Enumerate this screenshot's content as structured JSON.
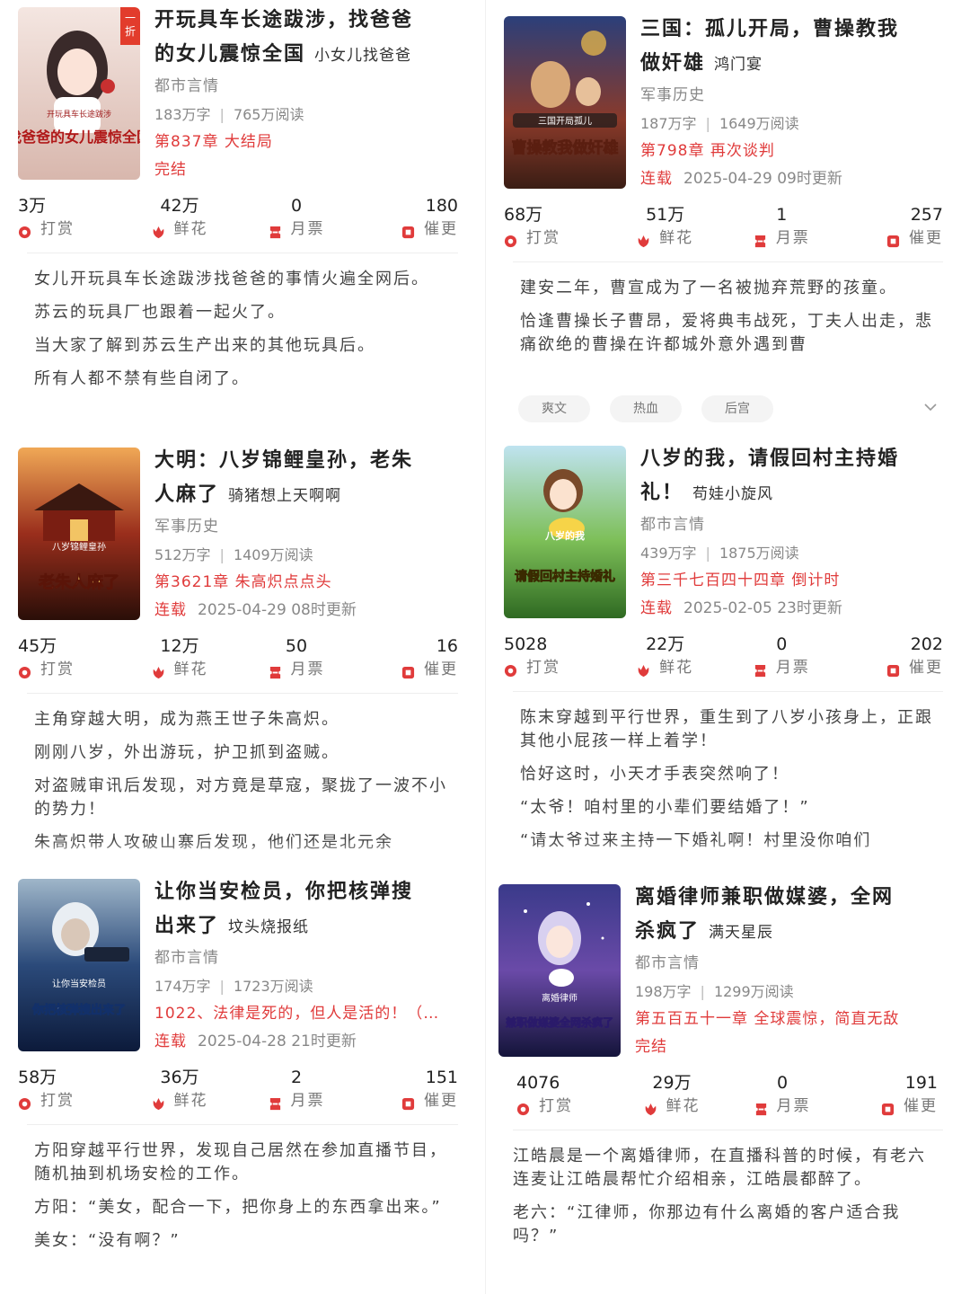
{
  "labels": {
    "reward": "打赏",
    "flower": "鲜花",
    "ticket": "月票",
    "urge": "催更"
  },
  "colors": {
    "accent": "#e03b3b"
  },
  "books": [
    {
      "title_line1": "开玩具车长途跋涉，找爸爸",
      "title_line2": "的女儿震惊全国",
      "author": "小女儿找爸爸",
      "category": "都市言情",
      "words": "183万字",
      "reads": "765万阅读",
      "chapter": "第837章 大结局",
      "status": "完结",
      "updated": "",
      "metrics": {
        "reward": "3万",
        "flower": "42万",
        "ticket": "0",
        "urge": "180"
      },
      "description": [
        "女儿开玩具车长途跋涉找爸爸的事情火遍全网后。",
        "苏云的玩具厂也跟着一起火了。",
        "当大家了解到苏云生产出来的其他玩具后。",
        "所有人都不禁有些自闭了。"
      ],
      "tags": [],
      "cover_badge": "一折",
      "cover_subtitle": "开玩具车长途跋涉",
      "cover_title": "找爸爸的女儿震惊全国"
    },
    {
      "title_line1": "三国：孤儿开局，曹操教我",
      "title_line2": "做奸雄",
      "author": "鸿门宴",
      "category": "军事历史",
      "words": "187万字",
      "reads": "1649万阅读",
      "chapter": "第798章 再次谈判",
      "status": "连载",
      "updated": "2025-04-29 09时更新",
      "metrics": {
        "reward": "68万",
        "flower": "51万",
        "ticket": "1",
        "urge": "257"
      },
      "description": [
        "建安二年，曹宣成为了一名被抛弃荒野的孩童。",
        "恰逢曹操长子曹昂，爱将典韦战死，丁夫人出走，悲痛欲绝的曹操在许都城外意外遇到曹"
      ],
      "tags": [
        "爽文",
        "热血",
        "后宫"
      ],
      "cover_badge": "",
      "cover_subtitle": "三国开局孤儿",
      "cover_title": "曹操教我做奸雄"
    },
    {
      "title_line1": "大明：八岁锦鲤皇孙，老朱",
      "title_line2": "人麻了",
      "author": "骑猪想上天啊啊",
      "category": "军事历史",
      "words": "512万字",
      "reads": "1409万阅读",
      "chapter": "第3621章 朱高炽点点头",
      "status": "连载",
      "updated": "2025-04-29 08时更新",
      "metrics": {
        "reward": "45万",
        "flower": "12万",
        "ticket": "50",
        "urge": "16"
      },
      "description": [
        "主角穿越大明，成为燕王世子朱高炽。",
        "刚刚八岁，外出游玩，护卫抓到盗贼。",
        "对盗贼审讯后发现，对方竟是草寇，聚拢了一波不小的势力！",
        "朱高炽带人攻破山寨后发现，他们还是北元余"
      ],
      "tags": [],
      "cover_badge": "",
      "cover_subtitle": "八岁锦鲤皇孙",
      "cover_title": "老朱人麻了"
    },
    {
      "title_line1": "八岁的我，请假回村主持婚",
      "title_line2": "礼！",
      "author": "苟娃小旋风",
      "category": "都市言情",
      "words": "439万字",
      "reads": "1875万阅读",
      "chapter": "第三千七百四十四章 倒计时",
      "status": "连载",
      "updated": "2025-02-05 23时更新",
      "metrics": {
        "reward": "5028",
        "flower": "22万",
        "ticket": "0",
        "urge": "202"
      },
      "description": [
        "陈末穿越到平行世界，重生到了八岁小孩身上，正跟其他小屁孩一样上着学！",
        "恰好这时，小天才手表突然响了！",
        "“太爷！咱村里的小辈们要结婚了！”",
        "“请太爷过来主持一下婚礼啊！村里没你咱们"
      ],
      "tags": [],
      "cover_badge": "",
      "cover_subtitle": "八岁的我",
      "cover_title": "请假回村主持婚礼"
    },
    {
      "title_line1": "让你当安检员，你把核弹搜",
      "title_line2": "出来了",
      "author": "坟头烧报纸",
      "category": "都市言情",
      "words": "174万字",
      "reads": "1723万阅读",
      "chapter": "1022、法律是死的，但人是活的！（…",
      "status": "连载",
      "updated": "2025-04-28 21时更新",
      "metrics": {
        "reward": "58万",
        "flower": "36万",
        "ticket": "2",
        "urge": "151"
      },
      "description": [
        "方阳穿越平行世界，发现自己居然在参加直播节目，随机抽到机场安检的工作。",
        "方阳：“美女，配合一下，把你身上的东西拿出来。”",
        "美女：“没有啊？”"
      ],
      "tags": [],
      "cover_badge": "",
      "cover_subtitle": "让你当安检员",
      "cover_title": "你把核弹搜出来了"
    },
    {
      "title_line1": "离婚律师兼职做媒婆，全网",
      "title_line2": "杀疯了",
      "author": "满天星辰",
      "category": "都市言情",
      "words": "198万字",
      "reads": "1299万阅读",
      "chapter": "第五百五十一章 全球震惊，简直无敌",
      "status": "完结",
      "updated": "",
      "metrics": {
        "reward": "4076",
        "flower": "29万",
        "ticket": "0",
        "urge": "191"
      },
      "description": [
        "江皓晨是一个离婚律师，在直播科普的时候，有老六连麦让江皓晨帮忙介绍相亲，江皓晨都醉了。",
        "老六：“江律师，你那边有什么离婚的客户适合我吗？”"
      ],
      "tags": [],
      "cover_badge": "",
      "cover_subtitle": "离婚律师",
      "cover_title": "兼职做媒婆全网杀疯了"
    }
  ]
}
